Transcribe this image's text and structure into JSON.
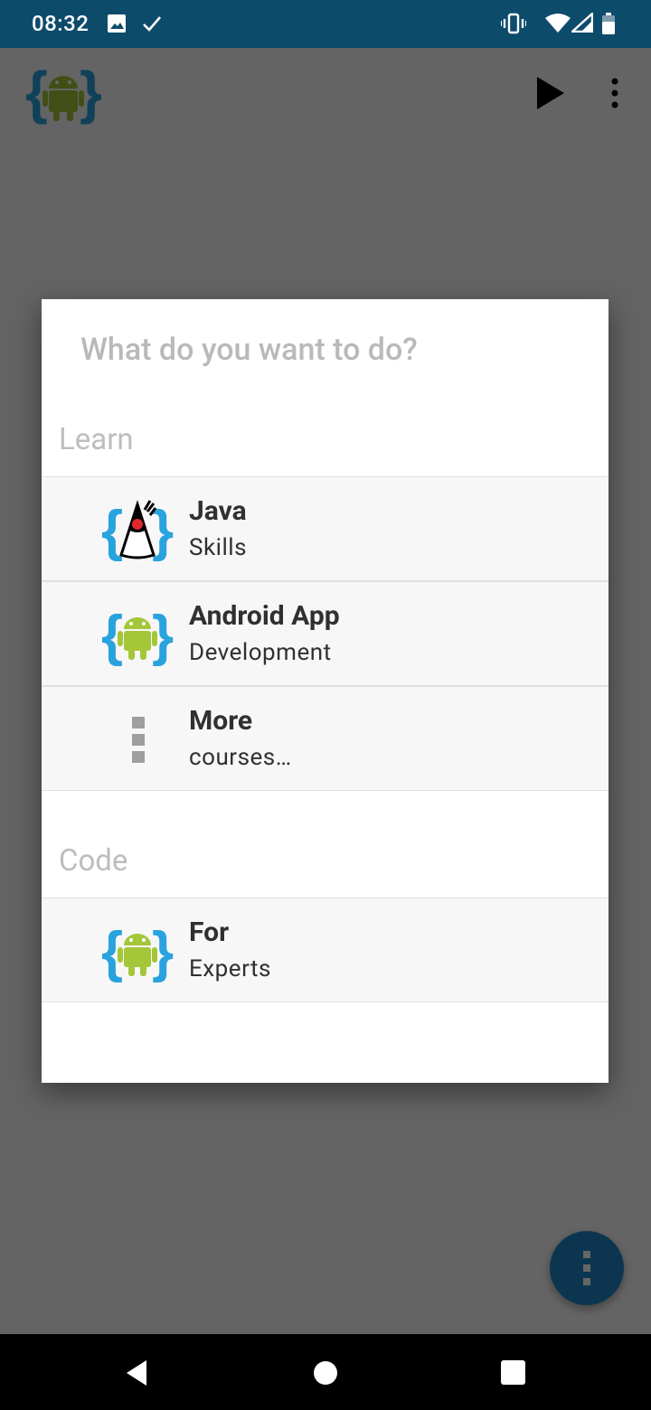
{
  "status_bar": {
    "time": "08:32",
    "left_icons": [
      "image-icon",
      "check-icon"
    ],
    "right_icons": [
      "vibrate-icon",
      "wifi-icon",
      "signal-icon",
      "battery-icon"
    ],
    "background": "#0d4b6b"
  },
  "app_bar": {
    "logo_icon": "android-braces-logo-icon",
    "actions": [
      "play-icon",
      "more-vert-icon"
    ]
  },
  "dialog": {
    "title": "What do you want to do?",
    "sections": [
      {
        "header": "Learn",
        "items": [
          {
            "title": "Java",
            "subtitle": "Skills",
            "icon": "java-duke-icon"
          },
          {
            "title": "Android App",
            "subtitle": "Development",
            "icon": "android-braces-icon"
          },
          {
            "title": "More",
            "subtitle": "courses…",
            "icon": "more-dots-icon"
          }
        ]
      },
      {
        "header": "Code",
        "items": [
          {
            "title": "For",
            "subtitle": "Experts",
            "icon": "android-braces-icon"
          }
        ]
      }
    ]
  },
  "fab": {
    "icon": "more-vert-icon",
    "color": "#1e88c8"
  },
  "nav_bar": {
    "buttons": [
      "back-icon",
      "home-icon",
      "recents-icon"
    ]
  },
  "colors": {
    "accent_blue": "#29a3dd",
    "android_green": "#a4c639"
  }
}
